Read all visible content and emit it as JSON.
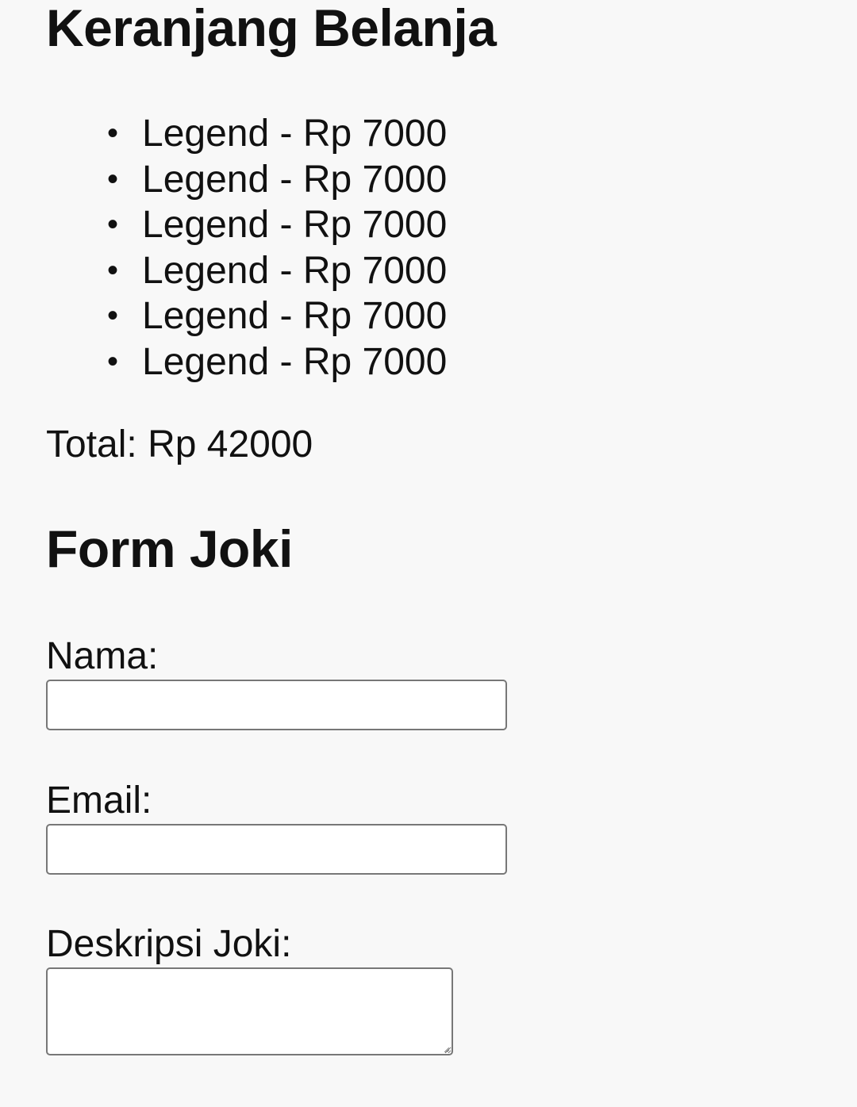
{
  "cart": {
    "title": "Keranjang Belanja",
    "items": [
      {
        "label": "Legend - Rp 7000"
      },
      {
        "label": "Legend - Rp 7000"
      },
      {
        "label": "Legend - Rp 7000"
      },
      {
        "label": "Legend - Rp 7000"
      },
      {
        "label": "Legend - Rp 7000"
      },
      {
        "label": "Legend - Rp 7000"
      }
    ],
    "total": "Total: Rp 42000"
  },
  "form": {
    "title": "Form Joki",
    "nama_label": "Nama:",
    "nama_value": "",
    "email_label": "Email:",
    "email_value": "",
    "deskripsi_label": "Deskripsi Joki:",
    "deskripsi_value": ""
  },
  "colors": {
    "background": "#f8f8f8",
    "text": "#111111",
    "field_border": "#777777"
  }
}
